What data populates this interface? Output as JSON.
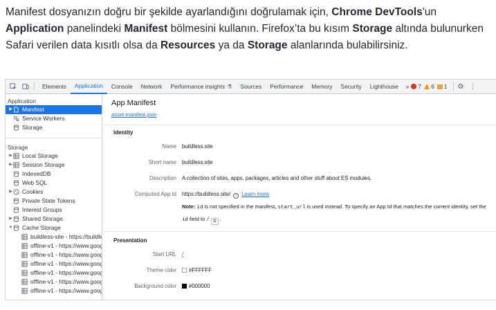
{
  "article": {
    "p1": "Manifest dosyanızın doğru bir şekilde ayarlandığını doğrulamak için, ",
    "b1": "Chrome DevTools",
    "p2": "'un ",
    "b2": "Application",
    "p3": " panelindeki ",
    "b3": "Manifest",
    "p4": " bölmesini kullanın. Firefox’ta bu kısım ",
    "b4": "Storage",
    "p5": " altında bulunurken Safari verilen data kısıtlı olsa da ",
    "b5": "Resources",
    "p6": " ya da ",
    "b6": "Storage",
    "p7": " alanlarında bulabilirsiniz."
  },
  "toolbar": {
    "tabs": [
      "Elements",
      "Application",
      "Console",
      "Network",
      "Performance insights",
      "Sources",
      "Performance",
      "Memory",
      "Security",
      "Lighthouse"
    ],
    "active_tab": "Application",
    "more": "»",
    "errors": "7",
    "warnings": "6",
    "issues": "1"
  },
  "sidebar": {
    "application_title": "Application",
    "application_items": [
      "Manifest",
      "Service Workers",
      "Storage"
    ],
    "storage_title": "Storage",
    "storage_items": [
      "Local Storage",
      "Session Storage",
      "IndexedDB",
      "Web SQL",
      "Cookies",
      "Private State Tokens",
      "Interest Groups",
      "Shared Storage",
      "Cache Storage"
    ],
    "cache_items": [
      "buildless-site - https://buildle",
      "offline-v1 - https://www.goog",
      "offline-v1 - https://www.goog",
      "offline-v1 - https://www.goog",
      "offline-v1 - https://www.goog",
      "offline-v1 - https://www.goog",
      "offline-v1 - https://www.goog"
    ]
  },
  "main": {
    "title": "App Manifest",
    "link": "asset-manifest.json",
    "identity": {
      "heading": "Identity",
      "name_label": "Name",
      "name_value": "buildless.site",
      "short_label": "Short name",
      "short_value": "buildless.site",
      "desc_label": "Description",
      "desc_value": "A collection of sites, apps, packages, articles and other stuff about ES modules.",
      "appid_label": "Computed App Id",
      "appid_value": "https://buildless.site/",
      "learn_more": "Learn more",
      "note_bold": "Note:",
      "note_code1": "id",
      "note_mid": " is not specified in the manifest, ",
      "note_code2": "start_url",
      "note_end": " is used instead. To specify an App Id that matches the current identity, set the",
      "note2_code": "id",
      "note2_text": " field to ",
      "note2_code2": "/"
    },
    "presentation": {
      "heading": "Presentation",
      "start_label": "Start URL",
      "start_value": "/",
      "theme_label": "Theme color",
      "theme_value": "#FFFFFF",
      "bg_label": "Background color",
      "bg_value": "#000000"
    }
  },
  "colors": {
    "accent": "#1a73e8",
    "error": "#d93025",
    "warning": "#f29900"
  }
}
